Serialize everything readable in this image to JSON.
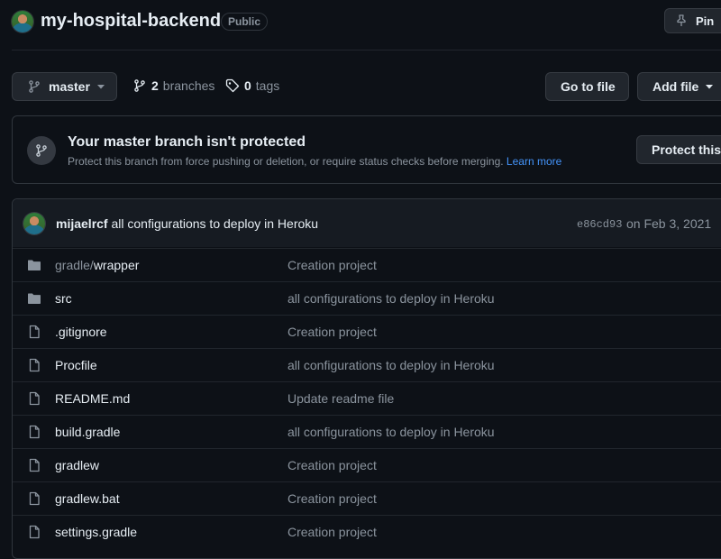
{
  "repo": {
    "name": "my-hospital-backend",
    "visibility": "Public",
    "pin_label": "Pin"
  },
  "toolbar": {
    "branch": "master",
    "branches_count": "2",
    "branches_label": "branches",
    "tags_count": "0",
    "tags_label": "tags",
    "go_to_file": "Go to file",
    "add_file": "Add file"
  },
  "protection": {
    "title": "Your master branch isn't protected",
    "description": "Protect this branch from force pushing or deletion, or require status checks before merging.",
    "learn_more": "Learn more",
    "button": "Protect this b"
  },
  "commit": {
    "author": "mijaelrcf",
    "message": "all configurations to deploy in Heroku",
    "sha": "e86cd93",
    "date": "on Feb 3, 2021"
  },
  "files": [
    {
      "type": "folder",
      "prefix": "gradle/",
      "name": "wrapper",
      "message": "Creation project"
    },
    {
      "type": "folder",
      "prefix": "",
      "name": "src",
      "message": "all configurations to deploy in Heroku"
    },
    {
      "type": "file",
      "prefix": "",
      "name": ".gitignore",
      "message": "Creation project"
    },
    {
      "type": "file",
      "prefix": "",
      "name": "Procfile",
      "message": "all configurations to deploy in Heroku"
    },
    {
      "type": "file",
      "prefix": "",
      "name": "README.md",
      "message": "Update readme file"
    },
    {
      "type": "file",
      "prefix": "",
      "name": "build.gradle",
      "message": "all configurations to deploy in Heroku"
    },
    {
      "type": "file",
      "prefix": "",
      "name": "gradlew",
      "message": "Creation project"
    },
    {
      "type": "file",
      "prefix": "",
      "name": "gradlew.bat",
      "message": "Creation project"
    },
    {
      "type": "file",
      "prefix": "",
      "name": "settings.gradle",
      "message": "Creation project"
    }
  ],
  "colors": {
    "background": "#0d1117",
    "border": "#30363d",
    "link": "#4493f8",
    "muted": "#8b949e"
  }
}
